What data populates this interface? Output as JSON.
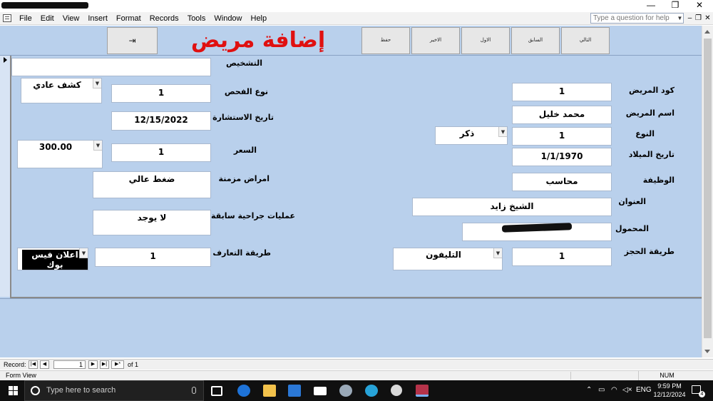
{
  "window": {
    "minimize": "—",
    "restore": "❐",
    "close": "✕"
  },
  "menubar": {
    "items": [
      "File",
      "Edit",
      "View",
      "Insert",
      "Format",
      "Records",
      "Tools",
      "Window",
      "Help"
    ],
    "help_placeholder": "Type a question for help",
    "mdi_minimize": "–",
    "mdi_restore": "❐",
    "mdi_close": "✕"
  },
  "header": {
    "title": "إضافة مريض",
    "exit_button": "⇥",
    "buttons": {
      "next": "التالي",
      "prev": "السابق",
      "first": "الاول",
      "last": "الاخير",
      "save": "حفظ"
    }
  },
  "fields": {
    "patient_code": {
      "label": "كود المريض",
      "value": "1"
    },
    "patient_name": {
      "label": "اسم المريض",
      "value": "محمد خليل"
    },
    "gender": {
      "label": "النوع",
      "value": "1",
      "combo": "ذكر"
    },
    "birth_date": {
      "label": "تاريخ الميلاد",
      "value": "1/1/1970"
    },
    "job": {
      "label": "الوظيفة",
      "value": "محاسب"
    },
    "address": {
      "label": "العنوان",
      "value": "الشيخ زايد"
    },
    "mobile": {
      "label": "المحمول",
      "value": ""
    },
    "booking_method": {
      "label": "طريقة الحجز",
      "value": "1",
      "combo": "التليفون"
    },
    "diagnosis": {
      "label": "التشخيص",
      "value": ""
    },
    "exam_type": {
      "label": "نوع الفحص",
      "value": "1",
      "combo": "كشف عادي"
    },
    "consult_date": {
      "label": "تاريخ الاستشارة",
      "value": "12/15/2022"
    },
    "price": {
      "label": "السعر",
      "value": "1",
      "combo": "300.00"
    },
    "chronic": {
      "label": "امراض مزمنة",
      "value": "ضغط عالي"
    },
    "surgeries": {
      "label": "عمليات جراحية سابقة",
      "value": "لا يوجد"
    },
    "referral": {
      "label": "طريقة التعارف",
      "value": "1",
      "combo": "اعلان فيس بوك"
    }
  },
  "record_nav": {
    "label": "Record:",
    "first": "|◀",
    "prev": "◀",
    "current": "1",
    "next": "▶",
    "last": "▶|",
    "new": "▶*",
    "of_text": "of  1"
  },
  "status": {
    "text": "Form View",
    "num": "NUM"
  },
  "taskbar": {
    "search_placeholder": "Type here to search",
    "lang": "ENG",
    "time": "9:59 PM",
    "date": "12/12/2024",
    "notif_count": "4"
  }
}
